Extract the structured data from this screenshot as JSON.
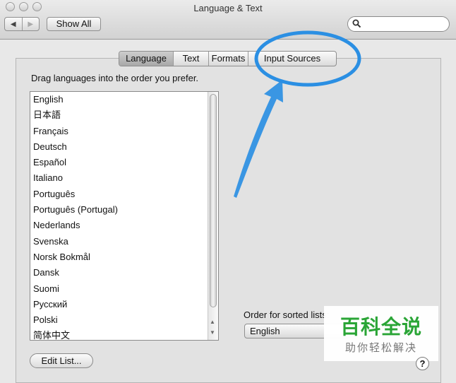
{
  "window": {
    "title": "Language & Text"
  },
  "toolbar": {
    "back_icon": "◀",
    "forward_icon": "▶",
    "show_all_label": "Show All"
  },
  "search": {
    "value": "",
    "placeholder": ""
  },
  "tabs": [
    {
      "label": "Language",
      "selected": true
    },
    {
      "label": "Text",
      "selected": false
    },
    {
      "label": "Formats",
      "selected": false
    },
    {
      "label": "Input Sources",
      "selected": false
    }
  ],
  "language_panel": {
    "instruction": "Drag languages into the order you prefer.",
    "languages": [
      "English",
      "日本語",
      "Français",
      "Deutsch",
      "Español",
      "Italiano",
      "Português",
      "Português (Portugal)",
      "Nederlands",
      "Svenska",
      "Norsk Bokmål",
      "Dansk",
      "Suomi",
      "Русский",
      "Polski",
      "简体中文"
    ],
    "edit_list_label": "Edit List...",
    "sort_order_label": "Order for sorted lists:",
    "sort_order_value": "English",
    "help_label": "?"
  },
  "watermark": {
    "title": "百科全说",
    "subtitle": "助你轻松解决"
  },
  "annotation": {
    "color": "#2b8fe3"
  }
}
